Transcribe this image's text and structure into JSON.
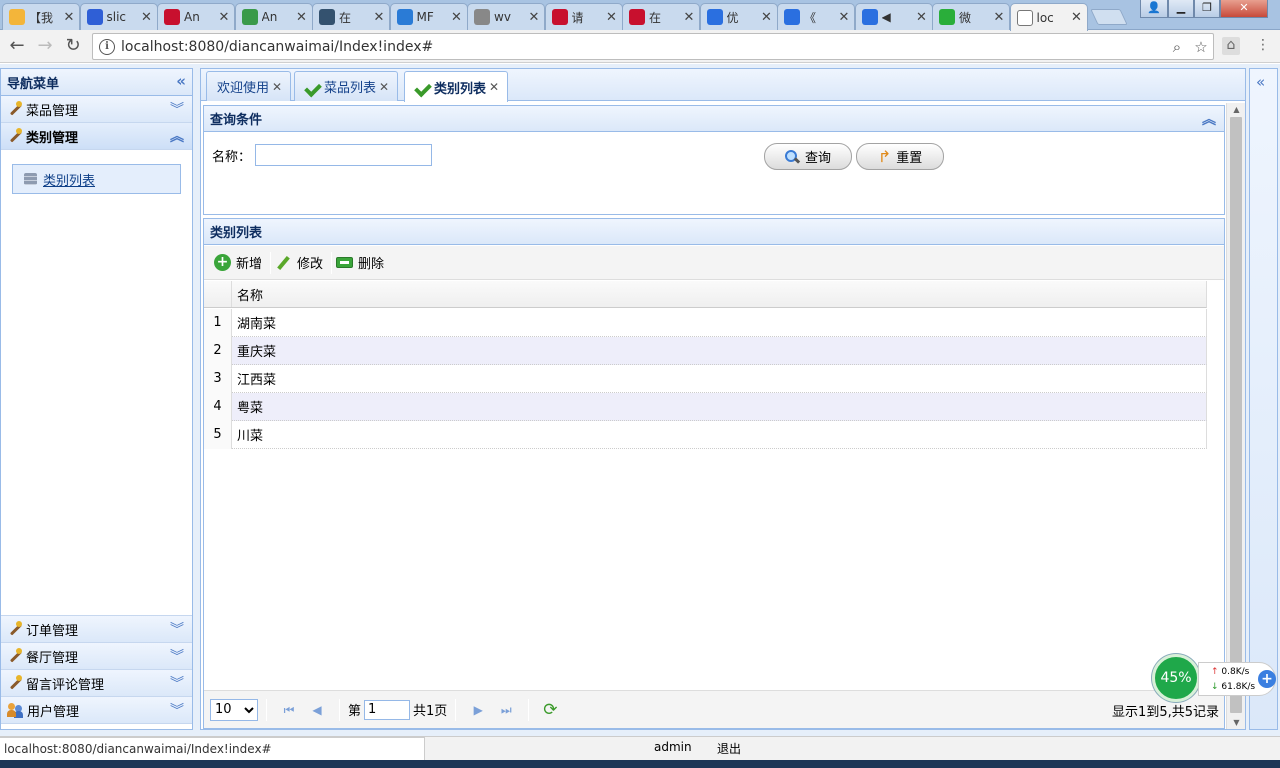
{
  "browser": {
    "tabs": [
      {
        "title": "【我",
        "favicon": "weather-icon",
        "color": "#f3b53a"
      },
      {
        "title": "slic",
        "favicon": "baidu-paw-icon",
        "color": "#2f5fd6"
      },
      {
        "title": "An",
        "favicon": "csdn-icon",
        "color": "#c8102e"
      },
      {
        "title": "An",
        "favicon": "green-c-icon",
        "color": "#3a9a4a"
      },
      {
        "title": "在",
        "favicon": "tumblr-icon",
        "color": "#34526f"
      },
      {
        "title": "MF",
        "favicon": "globe-icon",
        "color": "#2a7bd6"
      },
      {
        "title": "wv",
        "favicon": "paw-icon",
        "color": "#888888"
      },
      {
        "title": "请",
        "favicon": "csdn-icon",
        "color": "#c8102e"
      },
      {
        "title": "在",
        "favicon": "csdn-icon",
        "color": "#c8102e"
      },
      {
        "title": "优",
        "favicon": "play-icon",
        "color": "#2a6fe0"
      },
      {
        "title": "《",
        "favicon": "play-icon",
        "color": "#2a6fe0"
      },
      {
        "title": "◀",
        "favicon": "play-icon",
        "color": "#2a6fe0"
      },
      {
        "title": "微",
        "favicon": "wechat-icon",
        "color": "#2aae3a"
      },
      {
        "title": "loc",
        "favicon": "page-icon",
        "color": "#ffffff"
      }
    ],
    "url": "localhost:8080/diancanwaimai/Index!index#",
    "status_url": "localhost:8080/diancanwaimai/Index!index#"
  },
  "sidebar": {
    "title": "导航菜单",
    "groups_top": [
      {
        "label": "菜品管理",
        "name": "sidebar-group-dishes"
      },
      {
        "label": "类别管理",
        "name": "sidebar-group-categories"
      }
    ],
    "open_item": "类别列表",
    "groups_bottom": [
      {
        "label": "订单管理",
        "name": "sidebar-group-orders"
      },
      {
        "label": "餐厅管理",
        "name": "sidebar-group-restaurants"
      },
      {
        "label": "留言评论管理",
        "name": "sidebar-group-comments"
      },
      {
        "label": "用户管理",
        "name": "sidebar-group-users"
      }
    ]
  },
  "content_tabs": [
    {
      "label": "欢迎使用",
      "icon": false,
      "active": false
    },
    {
      "label": "菜品列表",
      "icon": true,
      "active": false
    },
    {
      "label": "类别列表",
      "icon": true,
      "active": true
    }
  ],
  "query": {
    "title": "查询条件",
    "name_label": "名称：",
    "name_value": "",
    "search_label": "查询",
    "reset_label": "重置"
  },
  "grid": {
    "title": "类别列表",
    "toolbar": {
      "add": "新增",
      "edit": "修改",
      "delete": "删除"
    },
    "columns": [
      "名称"
    ],
    "rows": [
      {
        "n": "1",
        "name": "湖南菜"
      },
      {
        "n": "2",
        "name": "重庆菜"
      },
      {
        "n": "3",
        "name": "江西菜"
      },
      {
        "n": "4",
        "name": "粤菜"
      },
      {
        "n": "5",
        "name": "川菜"
      }
    ],
    "pager": {
      "page_size": "10",
      "page_prefix": "第",
      "page_value": "1",
      "page_suffix": "共1页",
      "info": "显示1到5,共5记录"
    }
  },
  "speed_widget": {
    "percent": "45%",
    "upload": "0.8K/s",
    "download": "61.8K/s"
  },
  "footer": {
    "user": "admin",
    "logout": "退出"
  }
}
